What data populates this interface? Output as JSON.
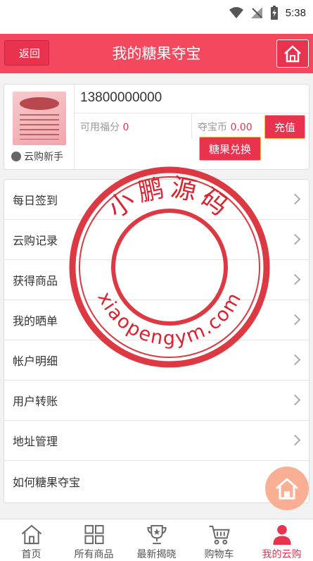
{
  "status": {
    "time": "5:38"
  },
  "header": {
    "back_label": "返回",
    "title": "我的糖果夺宝"
  },
  "profile": {
    "level": "云购新手",
    "phone": "13800000000",
    "points_label": "可用福分",
    "points_value": "0",
    "coins_label": "夺宝币",
    "coins_value": "0.00",
    "recharge_label": "充值",
    "exchange_label": "糖果兑换"
  },
  "menu": {
    "items": [
      {
        "label": "每日签到"
      },
      {
        "label": "云购记录"
      },
      {
        "label": "获得商品"
      },
      {
        "label": "我的晒单"
      },
      {
        "label": "帐户明细"
      },
      {
        "label": "用户转账"
      },
      {
        "label": "地址管理"
      },
      {
        "label": "如何糖果夺宝"
      }
    ]
  },
  "watermark": {
    "top_text": "小鹏源码",
    "bottom_text": "xiaopengym.com",
    "color": "#d9232e"
  },
  "tabbar": {
    "tabs": [
      {
        "label": "首页",
        "icon": "home-icon"
      },
      {
        "label": "所有商品",
        "icon": "grid-icon"
      },
      {
        "label": "最新揭晓",
        "icon": "trophy-icon"
      },
      {
        "label": "购物车",
        "icon": "cart-icon"
      },
      {
        "label": "我的云购",
        "icon": "user-icon"
      }
    ],
    "active_index": 4
  },
  "colors": {
    "brand": "#f4485f",
    "accent": "#e9324e"
  }
}
